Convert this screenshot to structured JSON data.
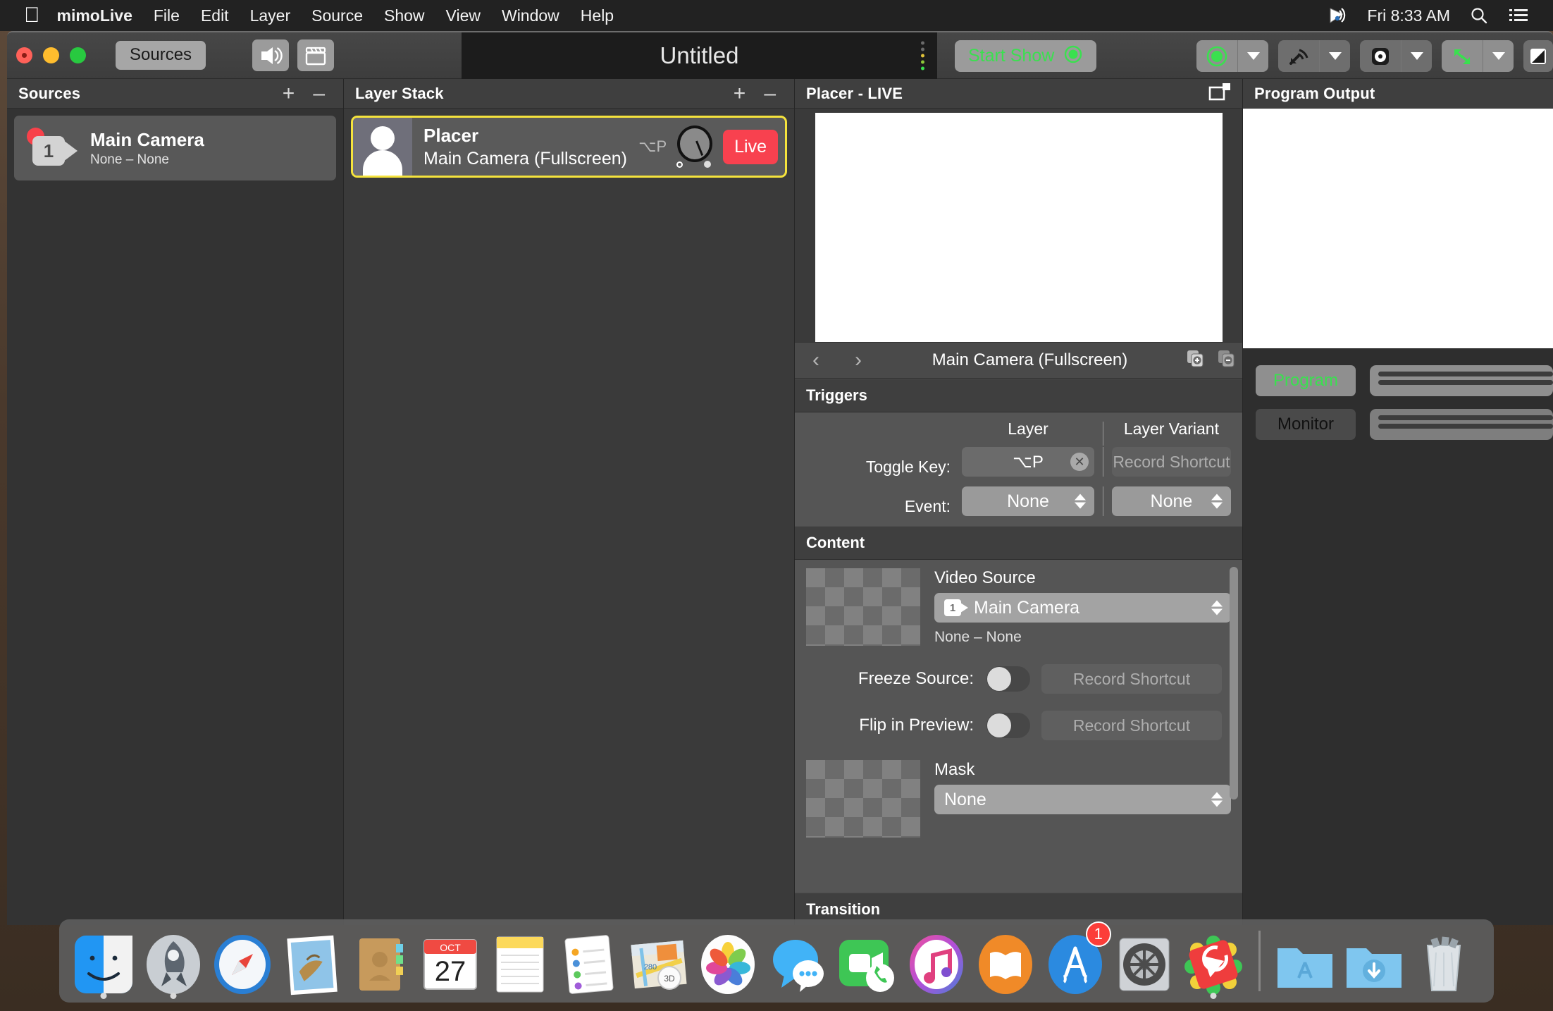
{
  "menubar": {
    "apple": "",
    "app_name": "mimoLive",
    "items": [
      "File",
      "Edit",
      "Layer",
      "Source",
      "Show",
      "View",
      "Window",
      "Help"
    ],
    "clock": "Fri 8:33 AM",
    "right_icons": [
      "quicktime-player-icon",
      "search-icon",
      "notification-center-icon"
    ]
  },
  "toolbar": {
    "sources_button": "Sources",
    "audio_button_icon": "audio-mute-icon",
    "clapper_button_icon": "clapperboard-icon",
    "document_title": "Untitled",
    "start_show_label": "Start Show",
    "right_controls": [
      {
        "name": "record-button",
        "icon": "record-circle-icon"
      },
      {
        "name": "stream-button",
        "icon": "broadcast-icon"
      },
      {
        "name": "playout-button",
        "icon": "playout-icon"
      },
      {
        "name": "fullscreen-button",
        "icon": "expand-arrows-icon"
      },
      {
        "name": "more-button",
        "icon": "panel-icon"
      }
    ]
  },
  "sources_panel": {
    "title": "Sources",
    "add_label": "+",
    "remove_label": "–",
    "items": [
      {
        "name": "Main Camera",
        "subtitle": "None – None",
        "number": "1",
        "live_dot": true
      }
    ]
  },
  "layer_stack": {
    "title": "Layer Stack",
    "add_label": "+",
    "remove_label": "–",
    "layers": [
      {
        "title": "Placer",
        "subtitle": "Main Camera (Fullscreen)",
        "shortcut": "⌥P",
        "live_label": "Live"
      }
    ]
  },
  "placer_panel": {
    "title": "Placer - LIVE",
    "detach_icon": "detach-window-icon",
    "variant_name": "Main Camera (Fullscreen)",
    "prev_label": "‹",
    "next_label": "›",
    "add_variant_icon": "add-variant-icon",
    "remove_variant_icon": "remove-variant-icon",
    "triggers": {
      "section_title": "Triggers",
      "col_layer": "Layer",
      "col_variant": "Layer Variant",
      "toggle_key_label": "Toggle Key:",
      "toggle_key_value": "⌥P",
      "toggle_key_clear": "✕",
      "variant_record_shortcut": "Record Shortcut",
      "event_label": "Event:",
      "event_layer_value": "None",
      "event_variant_value": "None"
    },
    "content": {
      "section_title": "Content",
      "video_source_label": "Video Source",
      "video_source_value": "Main Camera",
      "video_source_number": "1",
      "video_source_sub": "None – None",
      "freeze_source_label": "Freeze Source:",
      "freeze_source_shortcut": "Record Shortcut",
      "flip_preview_label": "Flip in Preview:",
      "flip_preview_shortcut": "Record Shortcut",
      "mask_label": "Mask",
      "mask_value": "None"
    },
    "transition": {
      "section_title": "Transition"
    }
  },
  "program_output": {
    "title": "Program Output",
    "program_label": "Program",
    "monitor_label": "Monitor"
  },
  "dock": {
    "items": [
      {
        "name": "finder",
        "running": true
      },
      {
        "name": "launchpad",
        "running": false
      },
      {
        "name": "safari",
        "running": true
      },
      {
        "name": "mail",
        "running": false
      },
      {
        "name": "contacts",
        "running": false
      },
      {
        "name": "calendar",
        "running": false,
        "month": "OCT",
        "day": "27"
      },
      {
        "name": "notes",
        "running": false
      },
      {
        "name": "reminders",
        "running": false
      },
      {
        "name": "maps",
        "running": false
      },
      {
        "name": "photos",
        "running": false
      },
      {
        "name": "messages",
        "running": false
      },
      {
        "name": "facetime",
        "running": false
      },
      {
        "name": "itunes",
        "running": false
      },
      {
        "name": "ibooks",
        "running": false
      },
      {
        "name": "app-store",
        "running": false,
        "badge": "1"
      },
      {
        "name": "system-preferences",
        "running": false
      },
      {
        "name": "mimolive",
        "running": true
      }
    ],
    "folders": [
      {
        "name": "applications-folder"
      },
      {
        "name": "downloads-folder"
      }
    ],
    "trash": {
      "name": "trash"
    }
  },
  "colors": {
    "accent_green": "#3ae04f",
    "live_red": "#f8414f",
    "selection_yellow": "#f5e33d",
    "window_bg": "#3b3b3b"
  }
}
